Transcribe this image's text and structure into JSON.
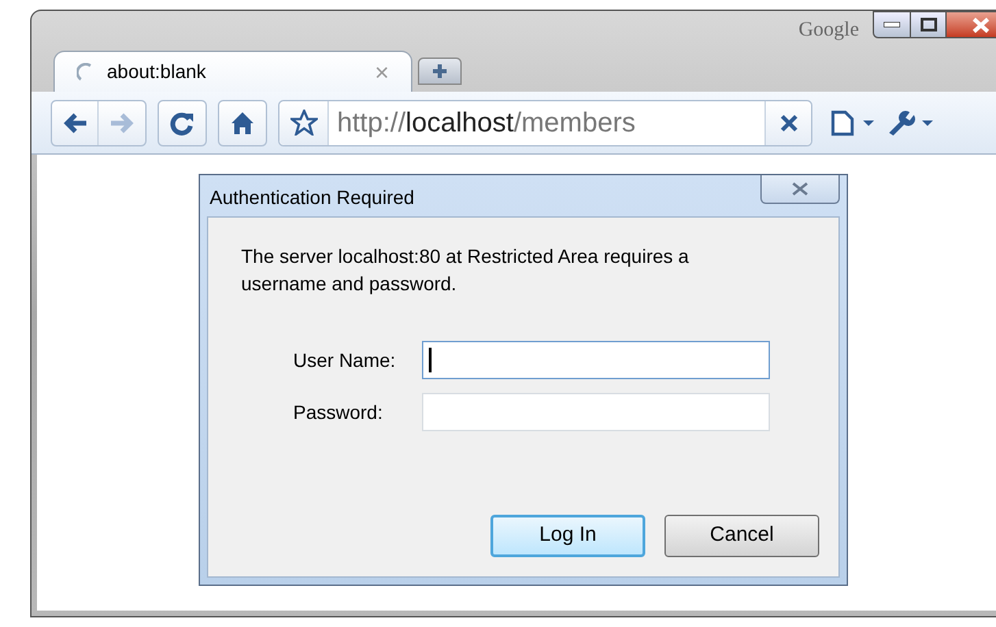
{
  "window": {
    "brand": "Google"
  },
  "tabs": [
    {
      "label": "about:blank",
      "selected": true,
      "loading": true,
      "close": "×"
    }
  ],
  "toolbar": {
    "url": {
      "scheme": "http://",
      "host": "localhost",
      "path": "/members"
    },
    "forward_disabled": true
  },
  "dialog": {
    "title": "Authentication Required",
    "message": "The server localhost:80 at Restricted Area requires a username and password.",
    "fields": [
      {
        "label": "User Name:",
        "focused": true
      },
      {
        "label": "Password:",
        "focused": false
      }
    ],
    "buttons": [
      {
        "label": "Log In",
        "default": true
      },
      {
        "label": "Cancel",
        "default": false
      }
    ]
  }
}
